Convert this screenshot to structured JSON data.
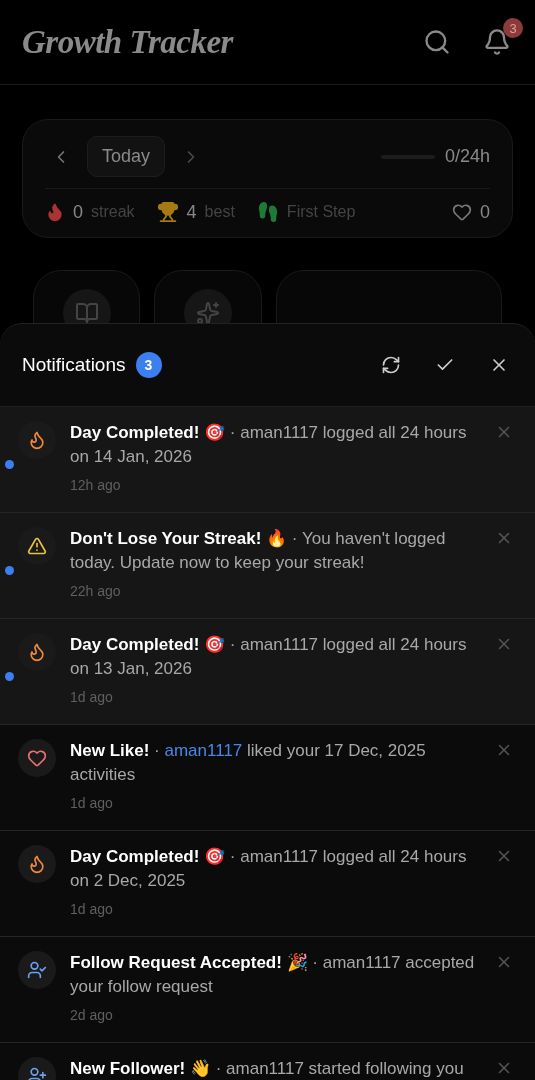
{
  "header": {
    "title": "Growth Tracker",
    "notification_count": "3"
  },
  "day_card": {
    "day_label": "Today",
    "progress": {
      "level": 0,
      "reading": "0/24h"
    },
    "stats": [
      {
        "kind": "streak",
        "value": "0",
        "label": "streak"
      },
      {
        "kind": "best",
        "value": "4",
        "label": "best"
      },
      {
        "kind": "badge",
        "label": "First Step"
      },
      {
        "kind": "likes",
        "value": "0"
      }
    ]
  },
  "tiles": [
    {
      "kind": "book"
    },
    {
      "kind": "sparkles"
    },
    {
      "kind": "wide"
    }
  ],
  "notifications": {
    "title": "Notifications",
    "count": "3",
    "items": [
      {
        "kind": "streak",
        "unread": true,
        "title": "Day Completed! 🎯",
        "separator": "·",
        "message": "aman1117 logged all 24 hours on 14 Jan, 2026",
        "time": "12h ago"
      },
      {
        "kind": "warning",
        "unread": true,
        "title": "Don't Lose Your Streak! 🔥",
        "separator": "·",
        "message": "You haven't logged today. Update now to keep your streak!",
        "time": "22h ago"
      },
      {
        "kind": "streak",
        "unread": true,
        "title": "Day Completed! 🎯",
        "separator": "·",
        "message": "aman1117 logged all 24 hours on 13 Jan, 2026",
        "time": "1d ago"
      },
      {
        "kind": "like",
        "unread": false,
        "title": "New Like!",
        "separator": "·",
        "mention": "aman1117",
        "message": "liked your 17 Dec, 2025 activities",
        "time": "1d ago"
      },
      {
        "kind": "streak",
        "unread": false,
        "title": "Day Completed! 🎯",
        "separator": "·",
        "message": "aman1117 logged all 24 hours on 2 Dec, 2025",
        "time": "1d ago"
      },
      {
        "kind": "follow_accepted",
        "unread": false,
        "title": "Follow Request Accepted! 🎉",
        "separator": "·",
        "message": "aman1117 accepted your follow request",
        "time": "2d ago"
      },
      {
        "kind": "follower",
        "title": "New Follower! 👋",
        "separator": "·",
        "message": "aman1117 started following you"
      }
    ]
  }
}
